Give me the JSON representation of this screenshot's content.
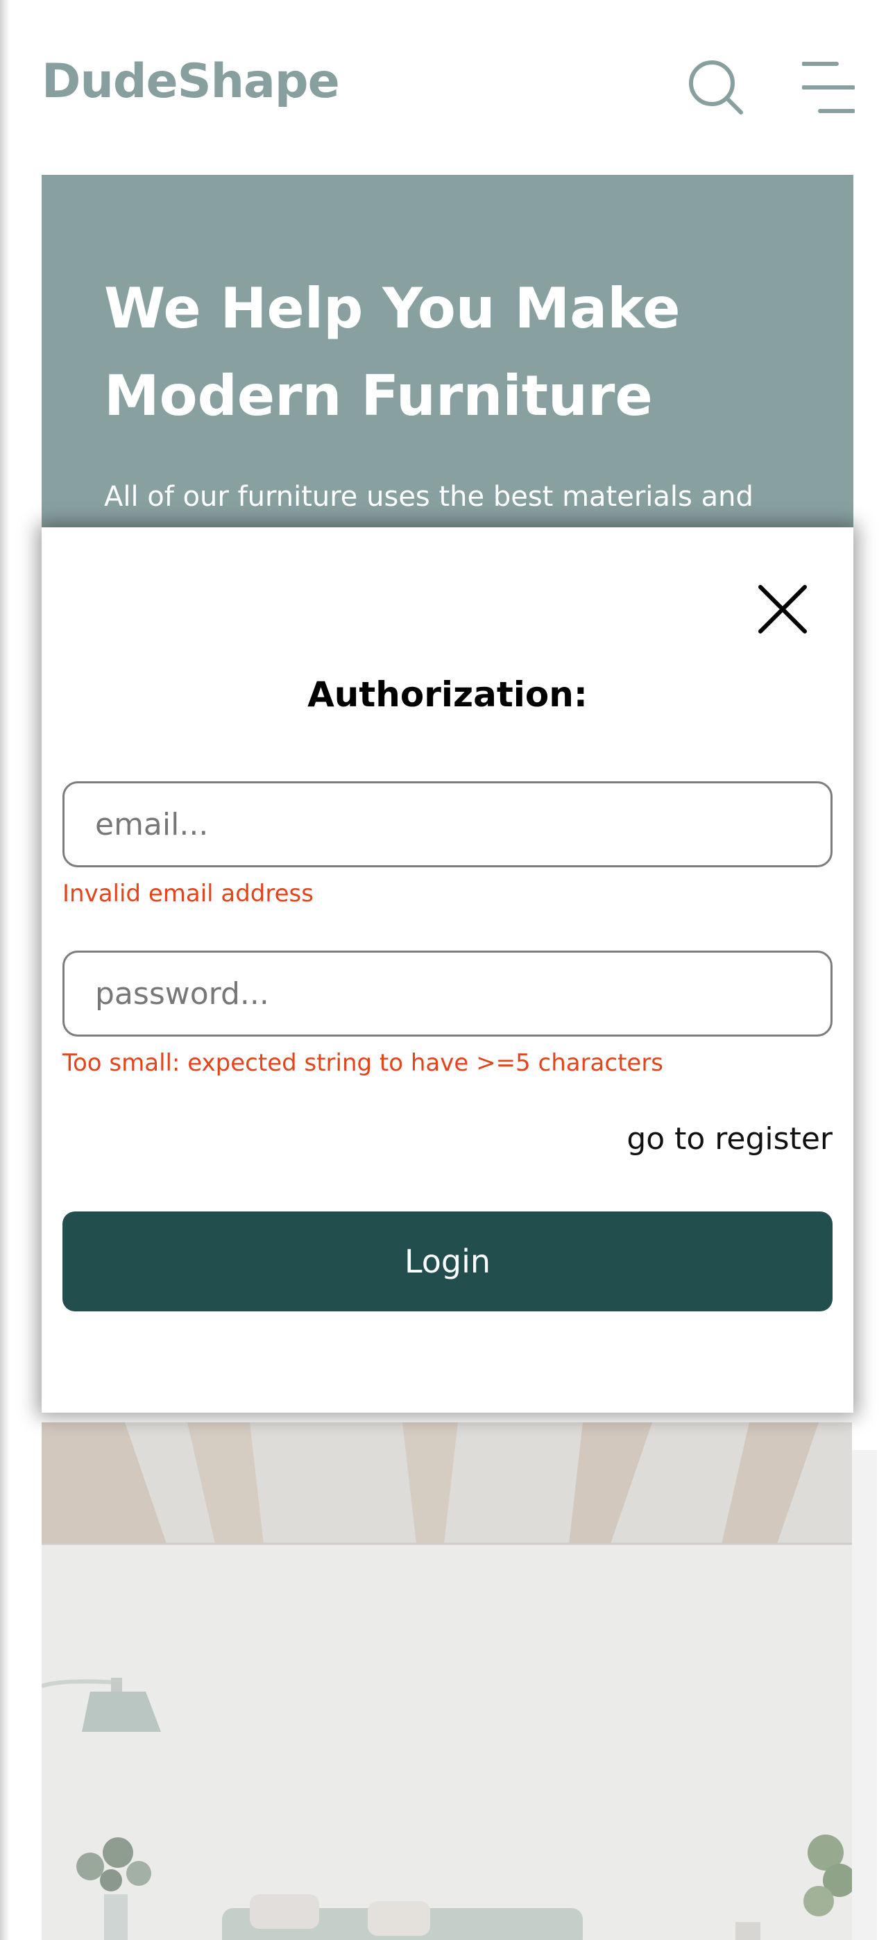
{
  "header": {
    "logo": "DudeShape",
    "search_icon": "search-icon",
    "menu_icon": "menu-icon"
  },
  "hero": {
    "title_line1": "We Help You Make",
    "title_line2": "Modern Furniture",
    "text": "All of our furniture uses the best materials and"
  },
  "modal": {
    "title": "Authorization:",
    "close_icon": "close-icon",
    "email": {
      "placeholder": "email...",
      "value": "",
      "error": "Invalid email address"
    },
    "password": {
      "placeholder": "password...",
      "value": "",
      "error": "Too small: expected string to have >=5 characters"
    },
    "register_link": "go to register",
    "login_button": "Login"
  },
  "colors": {
    "brand_muted": "#889f9f",
    "hero_bg": "#88a1a0",
    "primary_button": "#234e4e",
    "error": "#e5431a",
    "input_border": "#7d7d7d"
  }
}
